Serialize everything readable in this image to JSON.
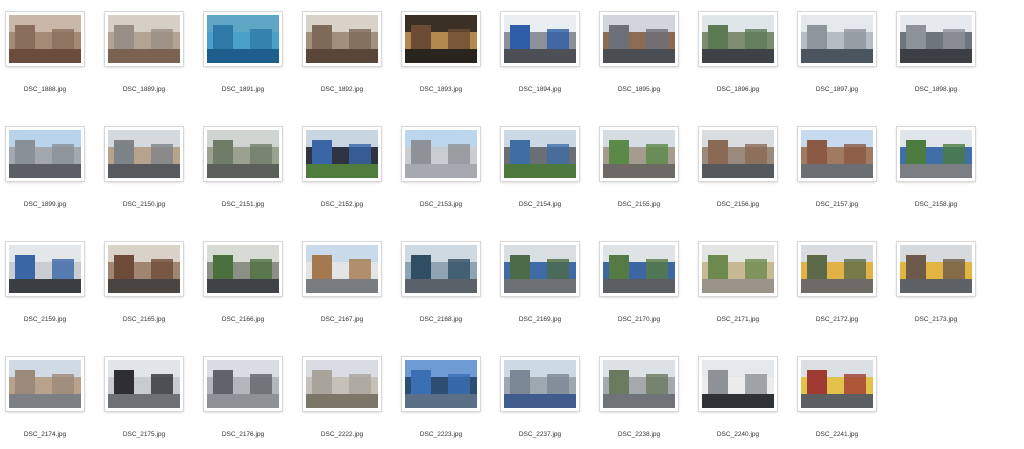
{
  "files": [
    {
      "name": "DSC_1888.jpg",
      "colors": [
        "#c9b8a8",
        "#8a6e5c",
        "#6b4d3e",
        "#a58a76"
      ]
    },
    {
      "name": "DSC_1889.jpg",
      "colors": [
        "#d6cfc6",
        "#9a8f86",
        "#7b6250",
        "#b3a393"
      ]
    },
    {
      "name": "DSC_1891.jpg",
      "colors": [
        "#5fa6c4",
        "#2f79a8",
        "#1e5d8c",
        "#4aa0c8"
      ]
    },
    {
      "name": "DSC_1892.jpg",
      "colors": [
        "#d9d2c8",
        "#7d6a59",
        "#5a4638",
        "#a28f7c"
      ]
    },
    {
      "name": "DSC_1893.jpg",
      "colors": [
        "#3b3026",
        "#6b4b33",
        "#2a241e",
        "#b28a4f"
      ]
    },
    {
      "name": "DSC_1894.jpg",
      "colors": [
        "#e9eef2",
        "#2e5ea8",
        "#4c4f55",
        "#8b9099"
      ]
    },
    {
      "name": "DSC_1895.jpg",
      "colors": [
        "#d0d6dc",
        "#6c7079",
        "#4a4d52",
        "#8a6b55"
      ]
    },
    {
      "name": "DSC_1896.jpg",
      "colors": [
        "#dfe6ea",
        "#5d7a55",
        "#3e4246",
        "#7d8c6e"
      ]
    },
    {
      "name": "DSC_1897.jpg",
      "colors": [
        "#e3e8ec",
        "#8f959c",
        "#4a5560",
        "#b5bcc3"
      ]
    },
    {
      "name": "DSC_1898.jpg",
      "colors": [
        "#e6eaee",
        "#8d9399",
        "#3b3f44",
        "#6f757c"
      ]
    },
    {
      "name": "DSC_1899.jpg",
      "colors": [
        "#b9d3ea",
        "#8a9097",
        "#5b5f65",
        "#a3a8ae"
      ]
    },
    {
      "name": "DSC_2150.jpg",
      "colors": [
        "#d4d9dd",
        "#7e8388",
        "#56595d",
        "#b6a38d"
      ]
    },
    {
      "name": "DSC_2151.jpg",
      "colors": [
        "#cfd4d0",
        "#6f7d68",
        "#5b5f5a",
        "#9aa28f"
      ]
    },
    {
      "name": "DSC_2152.jpg",
      "colors": [
        "#c8d6e2",
        "#3a66a8",
        "#4f7d3e",
        "#2e3540"
      ]
    },
    {
      "name": "DSC_2153.jpg",
      "colors": [
        "#bcd6ee",
        "#8e9297",
        "#a6aab0",
        "#c9cdd2"
      ]
    },
    {
      "name": "DSC_2154.jpg",
      "colors": [
        "#cbd9e4",
        "#3f6ea5",
        "#4d7a3c",
        "#6a6f75"
      ]
    },
    {
      "name": "DSC_2155.jpg",
      "colors": [
        "#d6dde2",
        "#5b8a48",
        "#6d6a66",
        "#a59c90"
      ]
    },
    {
      "name": "DSC_2156.jpg",
      "colors": [
        "#d9dde0",
        "#8a6a55",
        "#56595c",
        "#9a8a7c"
      ]
    },
    {
      "name": "DSC_2157.jpg",
      "colors": [
        "#c8dbee",
        "#8a5a45",
        "#6b6e72",
        "#a17a62"
      ]
    },
    {
      "name": "DSC_2158.jpg",
      "colors": [
        "#dfe5ea",
        "#4c7c3f",
        "#7b7e82",
        "#3f6ea8"
      ]
    },
    {
      "name": "DSC_2159.jpg",
      "colors": [
        "#e4e7ea",
        "#3a66a8",
        "#3a3d42",
        "#c9ccd0"
      ]
    },
    {
      "name": "DSC_2165.jpg",
      "colors": [
        "#d8d2c8",
        "#6e4c39",
        "#4a4541",
        "#a08672"
      ]
    },
    {
      "name": "DSC_2166.jpg",
      "colors": [
        "#d7dbd4",
        "#4c6f3e",
        "#3f4246",
        "#8c8f86"
      ]
    },
    {
      "name": "DSC_2167.jpg",
      "colors": [
        "#c9dbea",
        "#a5794f",
        "#7a7d80",
        "#e2e4e6"
      ]
    },
    {
      "name": "DSC_2168.jpg",
      "colors": [
        "#cfd9e2",
        "#2f4e63",
        "#5b6168",
        "#8fa3b3"
      ]
    },
    {
      "name": "DSC_2169.jpg",
      "colors": [
        "#d9dee2",
        "#4d6b46",
        "#6c6f73",
        "#3e6aa6"
      ]
    },
    {
      "name": "DSC_2170.jpg",
      "colors": [
        "#dfe3e6",
        "#567a44",
        "#5a5d61",
        "#3d67a2"
      ]
    },
    {
      "name": "DSC_2171.jpg",
      "colors": [
        "#e3e5e2",
        "#6d8a4e",
        "#9a9389",
        "#c7b994"
      ]
    },
    {
      "name": "DSC_2172.jpg",
      "colors": [
        "#d9dcde",
        "#5d6a4a",
        "#6e6a66",
        "#e1b347"
      ]
    },
    {
      "name": "DSC_2173.jpg",
      "colors": [
        "#d6dadd",
        "#6e5a4a",
        "#5e6165",
        "#e2b441"
      ]
    },
    {
      "name": "DSC_2174.jpg",
      "colors": [
        "#cfdae4",
        "#9b8a79",
        "#7c7f83",
        "#b8a28c"
      ]
    },
    {
      "name": "DSC_2175.jpg",
      "colors": [
        "#e2e5e8",
        "#2f2f33",
        "#6e7276",
        "#c8cbcf"
      ]
    },
    {
      "name": "DSC_2176.jpg",
      "colors": [
        "#d7dde3",
        "#5f646a",
        "#8e9297",
        "#b3b7bb"
      ]
    },
    {
      "name": "DSC_2222.jpg",
      "colors": [
        "#d9dde3",
        "#a8a39b",
        "#7b7668",
        "#c5c1b8"
      ]
    },
    {
      "name": "DSC_2223.jpg",
      "colors": [
        "#6e9bd3",
        "#3a6fb5",
        "#5b6f86",
        "#2e4d73"
      ]
    },
    {
      "name": "DSC_2237.jpg",
      "colors": [
        "#cdd9e3",
        "#7b8794",
        "#3f5c8c",
        "#9ea8b1"
      ]
    },
    {
      "name": "DSC_2238.jpg",
      "colors": [
        "#dde2e6",
        "#6a7a5f",
        "#6f7378",
        "#a4a9ad"
      ]
    },
    {
      "name": "DSC_2240.jpg",
      "colors": [
        "#e5e8eb",
        "#8e9296",
        "#2f3235",
        "#ececec"
      ]
    },
    {
      "name": "DSC_2241.jpg",
      "colors": [
        "#dadfe3",
        "#a03b33",
        "#5c5f62",
        "#e3c24c"
      ]
    }
  ]
}
